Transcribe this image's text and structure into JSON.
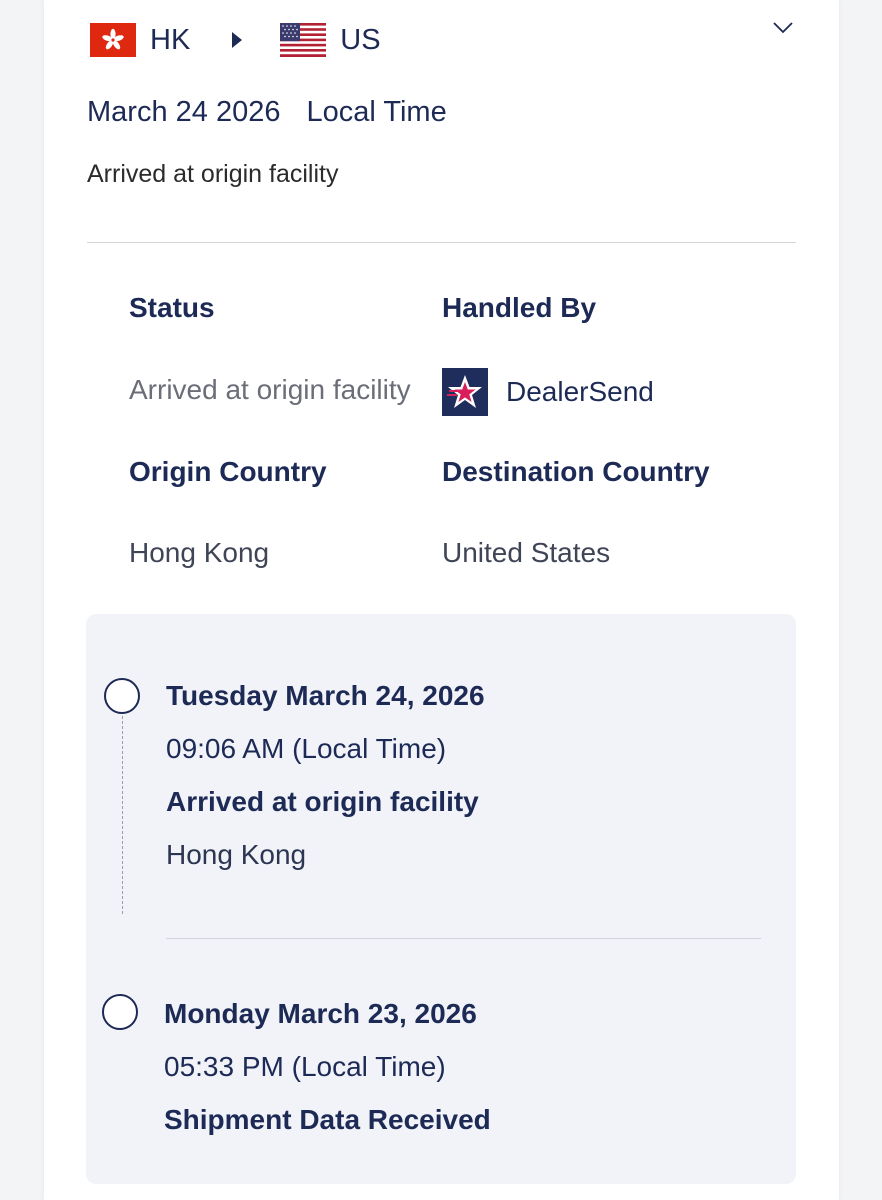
{
  "route": {
    "origin_code": "HK",
    "destination_code": "US",
    "origin_flag_icon": "hong-kong-flag-icon",
    "destination_flag_icon": "us-flag-icon",
    "arrow_icon": "triangle-right-icon",
    "expand_icon": "chevron-down-icon"
  },
  "header": {
    "date": "March 24 2026",
    "time_zone": "Local Time",
    "summary_status": "Arrived at origin facility"
  },
  "details": {
    "status_label": "Status",
    "status_value": "Arrived at origin facility",
    "handled_by_label": "Handled By",
    "carrier_name": "DealerSend",
    "carrier_logo_icon": "dealersend-star-logo",
    "origin_country_label": "Origin Country",
    "origin_country_value": "Hong Kong",
    "destination_country_label": "Destination Country",
    "destination_country_value": "United States"
  },
  "timeline": {
    "events": [
      {
        "date": "Tuesday March 24, 2026",
        "time": "09:06 AM (Local Time)",
        "event": "Arrived at origin facility",
        "location": "Hong Kong"
      },
      {
        "date": "Monday March 23, 2026",
        "time": "05:33 PM (Local Time)",
        "event": "Shipment Data Received"
      }
    ]
  },
  "colors": {
    "navy": "#1c2a55",
    "hk_red": "#de2910",
    "us_red": "#b22234",
    "us_blue": "#3c3b6e",
    "timeline_bg": "#f1f3f8"
  }
}
